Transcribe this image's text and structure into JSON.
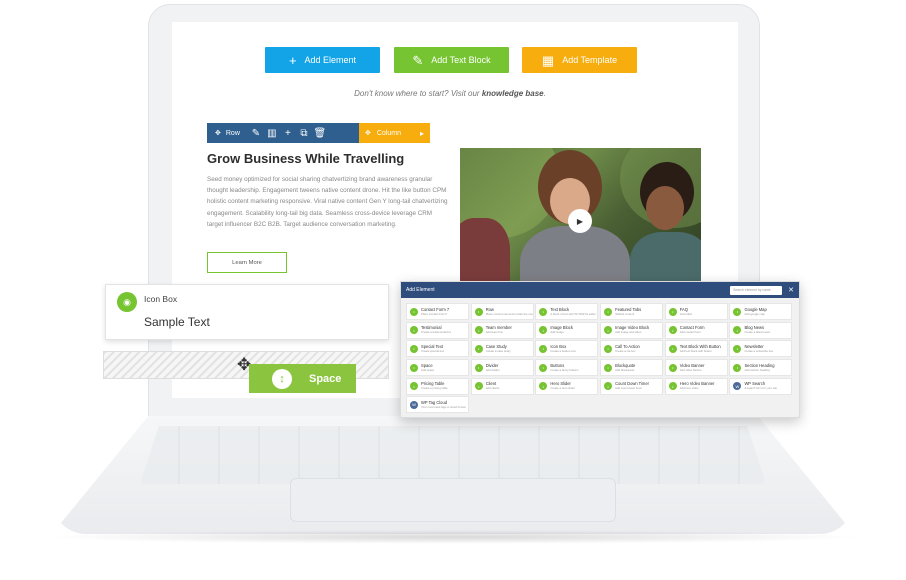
{
  "toolbar": {
    "add_element": "Add Element",
    "add_text_block": "Add Text Block",
    "add_template": "Add Template"
  },
  "hint": {
    "prefix": "Don't know where to start? Visit our ",
    "link": "knowledge base",
    "suffix": "."
  },
  "row_controls": {
    "row_label": "Row",
    "column_label": "Column"
  },
  "content": {
    "title": "Grow Business While Travelling",
    "paragraph": "Seed money optimized for social sharing chatvertizing brand awareness granular thought leadership. Engagement tweens native content drone. Hit the like button CPM holistic content marketing responsive. Viral native content Gen Y long-tail chatvertizing engagement. Scalability long-tail big data. Seamless cross-device leverage CRM target influencer B2C B2B. Target audience conversation marketing.",
    "button": "Learn More"
  },
  "icon_box": {
    "label": "Icon Box",
    "sample": "Sample Text"
  },
  "space": {
    "label": "Space"
  },
  "panel": {
    "title": "Add Element",
    "search_placeholder": "Search element by name",
    "elements": [
      {
        "name": "Contact Form 7",
        "desc": "Place Contact Form7",
        "icon": "form-icon"
      },
      {
        "name": "Row",
        "desc": "Place content elements inside the row",
        "icon": "row-icon"
      },
      {
        "name": "Text Block",
        "desc": "A block of text with WYSIWYG editor",
        "icon": "text-icon"
      },
      {
        "name": "Featured Tabs",
        "desc": "Tabbed content",
        "icon": "tabs-icon"
      },
      {
        "name": "FAQ",
        "desc": "Accordion",
        "icon": "faq-icon"
      },
      {
        "name": "Google Map",
        "desc": "Add google map",
        "icon": "map-icon"
      },
      {
        "name": "Testimonial",
        "desc": "Create a testimonial box",
        "icon": "quote-icon"
      },
      {
        "name": "Team member",
        "desc": "Add team box",
        "icon": "team-icon"
      },
      {
        "name": "Image Block",
        "desc": "Add image",
        "icon": "image-icon"
      },
      {
        "name": "Image Video Block",
        "desc": "Add image and video",
        "icon": "video-icon"
      },
      {
        "name": "Contact Form",
        "desc": "Add contact form",
        "icon": "mail-icon"
      },
      {
        "name": "Blog News",
        "desc": "Create a latest news",
        "icon": "news-icon"
      },
      {
        "name": "Special Text",
        "desc": "Create special text",
        "icon": "special-text-icon"
      },
      {
        "name": "Case Study",
        "desc": "Create a case study",
        "icon": "case-icon"
      },
      {
        "name": "Icon Box",
        "desc": "Create a feature box",
        "icon": "icon-box-icon"
      },
      {
        "name": "Call To Action",
        "desc": "Create a cta box",
        "icon": "cta-icon"
      },
      {
        "name": "Text Block With Button",
        "desc": "Add text block with button",
        "icon": "text-button-icon"
      },
      {
        "name": "Newsletter",
        "desc": "Create a subscribe box",
        "icon": "newsletter-icon"
      },
      {
        "name": "Space",
        "desc": "Add space",
        "icon": "space-icon"
      },
      {
        "name": "Divider",
        "desc": "Add divider",
        "icon": "divider-icon"
      },
      {
        "name": "Buttons",
        "desc": "Create a fancy buttons",
        "icon": "buttons-icon"
      },
      {
        "name": "Blockquote",
        "desc": "Add blockquote",
        "icon": "blockquote-icon"
      },
      {
        "name": "Video Banner",
        "desc": "Add video banner",
        "icon": "video-banner-icon"
      },
      {
        "name": "Section Heading",
        "desc": "Add section heading",
        "icon": "heading-icon"
      },
      {
        "name": "Pricing Table",
        "desc": "Create a pricing table",
        "icon": "pricing-icon"
      },
      {
        "name": "Client",
        "desc": "Add clients",
        "icon": "client-icon"
      },
      {
        "name": "Hero Slider",
        "desc": "Create a hero slider",
        "icon": "slider-icon"
      },
      {
        "name": "Count Down Timer",
        "desc": "Add count down timer",
        "icon": "timer-icon"
      },
      {
        "name": "Hero Video Banner",
        "desc": "Add hero video",
        "icon": "hero-video-icon"
      },
      {
        "name": "WP Search",
        "desc": "A search form for your site",
        "icon": "wordpress-icon"
      },
      {
        "name": "WP Tag Cloud",
        "desc": "Your most used tags in cloud format",
        "icon": "wordpress-icon"
      }
    ]
  },
  "colors": {
    "blue": "#12a4e6",
    "green": "#76c431",
    "orange": "#f6ad0d",
    "navy": "#2e5f8e",
    "panel_header": "#2e4d7c"
  }
}
